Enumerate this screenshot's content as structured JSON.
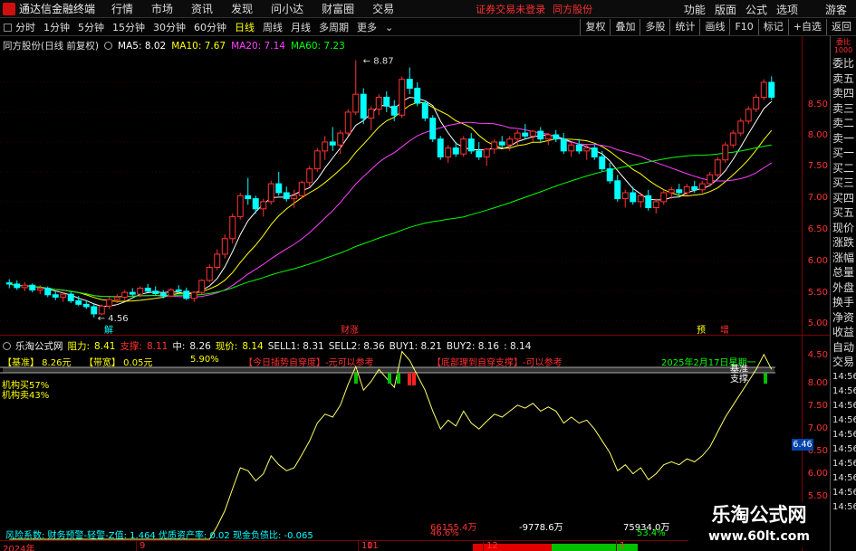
{
  "menubar": {
    "app_title": "通达信金融终端",
    "items": [
      "行情",
      "市场",
      "资讯",
      "发现",
      "问小达",
      "财富圈",
      "交易"
    ],
    "notice": "证券交易未登录",
    "broker": "同方股份",
    "right_items": [
      "功能",
      "版面",
      "公式",
      "选项"
    ],
    "guest": "游客"
  },
  "toolbar": {
    "periods": [
      "分时",
      "1分钟",
      "5分钟",
      "15分钟",
      "30分钟",
      "60分钟",
      "日线",
      "周线",
      "月线",
      "多周期",
      "更多"
    ],
    "active_period": "日线",
    "right_buttons": [
      "复权",
      "叠加",
      "多股",
      "统计",
      "画线",
      "F10",
      "标记",
      "+自选",
      "返回"
    ]
  },
  "stock_header": {
    "name": "同方股份(日线 前复权)",
    "ma5": "MA5: 8.02",
    "ma10": "MA10: 7.67",
    "ma20": "MA20: 7.14",
    "ma60": "MA60: 7.23"
  },
  "chart_markers": {
    "high": "8.87",
    "low": "4.56",
    "caizhang": "财涨",
    "jie": "解",
    "yu": "预",
    "zeng": "增"
  },
  "price_axis": [
    "8.50",
    "8.00",
    "7.50",
    "7.00",
    "6.50",
    "6.00",
    "5.50",
    "5.00",
    "4.50"
  ],
  "indicator_axis": [
    "8.00",
    "7.50",
    "7.00",
    "6.50",
    "6.00",
    "5.50"
  ],
  "indicator_tag": "6.46",
  "indicator_header": {
    "name": "乐淘公式网",
    "resistance_label": "阻力:",
    "resistance": "8.41",
    "support_label": "支撑:",
    "support": "8.11",
    "mid_label": "中:",
    "mid": "8.26",
    "current_label": "现价:",
    "current": "8.14",
    "sell1": "SELL1: 8.31",
    "sell2": "SELL2: 8.36",
    "buy1": "BUY1: 8.21",
    "buy2": "BUY2: 8.16",
    "extra": ": 8.14"
  },
  "indicator_row2": {
    "base": "【基准】 8.26元",
    "width": "【带宽】 0.05元",
    "pct": "5.90%",
    "hint1": "【今日插势自穿度】-元可以参考",
    "hint2": "【底部理到自穿支撑】-可以参考",
    "date": "2025年2月17日星期一"
  },
  "indicator_left": {
    "inst_buy": "机构买57%",
    "inst_sell": "机构卖43%"
  },
  "indicator_annotations": {
    "base": "基准",
    "support": "支撑"
  },
  "bottom_info": "风险系数: 财务预警-轻警-Z值: 1.464  优质资产率: 0.02  现金负债比: -0.065",
  "flow": {
    "left_value": "66155.4万",
    "left_pct": "46.6%",
    "mid_value": "-9778.6万",
    "right_value": "75934.0万",
    "right_pct": "53.4%"
  },
  "date_axis": [
    "2024年",
    "9",
    "10",
    "11",
    "12",
    "1"
  ],
  "side_panel": {
    "header": "委比 1000",
    "items": [
      "委比",
      "卖五",
      "卖四",
      "卖三",
      "卖二",
      "卖一",
      "买一",
      "买二",
      "买三",
      "买四",
      "买五",
      "现价",
      "涨跌",
      "涨幅",
      "总量",
      "外盘",
      "换手",
      "净资",
      "收益",
      "自动",
      "交易"
    ],
    "times": [
      "14:56",
      "14:56",
      "14:56",
      "14:56",
      "14:56",
      "14:56",
      "14:56",
      "14:56",
      "14:56",
      "14:56"
    ]
  },
  "watermark": {
    "title": "乐淘公式网",
    "url": "www.60lt.com"
  },
  "colors": {
    "up": "#ff3333",
    "down": "#00ffff",
    "ma5": "#ffffff",
    "ma10": "#ffff00",
    "ma20": "#ff40ff",
    "ma60": "#00ff00",
    "indicator_line": "#ffff66"
  },
  "chart_data": {
    "type": "candlestick",
    "title": "同方股份(日线 前复权)",
    "candles": [
      [
        5.14,
        5.2,
        5.05,
        5.12
      ],
      [
        5.12,
        5.18,
        5.02,
        5.06
      ],
      [
        5.06,
        5.15,
        5.0,
        5.1
      ],
      [
        5.1,
        5.13,
        4.98,
        5.02
      ],
      [
        5.02,
        5.1,
        4.95,
        5.05
      ],
      [
        5.05,
        5.08,
        4.9,
        4.94
      ],
      [
        4.94,
        5.0,
        4.85,
        4.9
      ],
      [
        4.9,
        4.98,
        4.82,
        4.95
      ],
      [
        4.95,
        5.0,
        4.8,
        4.84
      ],
      [
        4.84,
        4.92,
        4.75,
        4.78
      ],
      [
        4.78,
        4.85,
        4.7,
        4.74
      ],
      [
        4.74,
        4.8,
        4.56,
        4.62
      ],
      [
        4.62,
        4.78,
        4.6,
        4.75
      ],
      [
        4.75,
        4.9,
        4.7,
        4.86
      ],
      [
        4.86,
        4.95,
        4.8,
        4.9
      ],
      [
        4.9,
        5.02,
        4.85,
        4.98
      ],
      [
        4.98,
        5.05,
        4.92,
        4.95
      ],
      [
        4.95,
        5.08,
        4.9,
        5.05
      ],
      [
        5.05,
        5.12,
        4.98,
        5.0
      ],
      [
        5.0,
        5.08,
        4.92,
        4.96
      ],
      [
        4.96,
        5.02,
        4.88,
        4.92
      ],
      [
        4.92,
        5.05,
        4.9,
        5.02
      ],
      [
        5.02,
        5.1,
        4.96,
        5.0
      ],
      [
        5.0,
        5.06,
        4.85,
        4.88
      ],
      [
        4.88,
        5.0,
        4.82,
        4.98
      ],
      [
        4.98,
        5.2,
        4.95,
        5.18
      ],
      [
        5.18,
        5.45,
        5.15,
        5.4
      ],
      [
        5.4,
        5.7,
        5.35,
        5.62
      ],
      [
        5.62,
        5.95,
        5.55,
        5.88
      ],
      [
        5.88,
        6.3,
        5.8,
        6.25
      ],
      [
        6.25,
        6.65,
        6.2,
        6.6
      ],
      [
        6.6,
        6.9,
        6.45,
        6.55
      ],
      [
        6.55,
        6.6,
        6.3,
        6.38
      ],
      [
        6.38,
        6.55,
        6.25,
        6.5
      ],
      [
        6.5,
        6.85,
        6.45,
        6.8
      ],
      [
        6.8,
        7.0,
        6.6,
        6.65
      ],
      [
        6.65,
        6.75,
        6.5,
        6.55
      ],
      [
        6.55,
        6.7,
        6.4,
        6.6
      ],
      [
        6.6,
        6.85,
        6.55,
        6.82
      ],
      [
        6.82,
        7.1,
        6.75,
        7.05
      ],
      [
        7.05,
        7.4,
        7.0,
        7.35
      ],
      [
        7.35,
        7.6,
        7.2,
        7.5
      ],
      [
        7.5,
        7.75,
        7.35,
        7.45
      ],
      [
        7.45,
        7.7,
        7.3,
        7.65
      ],
      [
        7.65,
        8.05,
        7.6,
        8.0
      ],
      [
        8.0,
        8.87,
        7.95,
        8.3
      ],
      [
        8.3,
        8.4,
        7.8,
        7.9
      ],
      [
        7.9,
        8.1,
        7.7,
        8.05
      ],
      [
        8.05,
        8.3,
        7.95,
        8.25
      ],
      [
        8.25,
        8.35,
        8.0,
        8.1
      ],
      [
        8.1,
        8.2,
        7.85,
        7.95
      ],
      [
        7.95,
        8.6,
        7.9,
        8.55
      ],
      [
        8.55,
        8.75,
        8.3,
        8.4
      ],
      [
        8.4,
        8.5,
        8.1,
        8.15
      ],
      [
        8.15,
        8.2,
        7.85,
        7.9
      ],
      [
        7.9,
        7.95,
        7.5,
        7.55
      ],
      [
        7.55,
        7.6,
        7.2,
        7.25
      ],
      [
        7.25,
        7.45,
        7.15,
        7.4
      ],
      [
        7.4,
        7.5,
        7.25,
        7.3
      ],
      [
        7.3,
        7.6,
        7.25,
        7.55
      ],
      [
        7.55,
        7.65,
        7.3,
        7.35
      ],
      [
        7.35,
        7.5,
        7.2,
        7.25
      ],
      [
        7.25,
        7.4,
        7.1,
        7.38
      ],
      [
        7.38,
        7.55,
        7.3,
        7.5
      ],
      [
        7.5,
        7.6,
        7.4,
        7.45
      ],
      [
        7.45,
        7.6,
        7.35,
        7.55
      ],
      [
        7.55,
        7.7,
        7.45,
        7.65
      ],
      [
        7.65,
        7.8,
        7.55,
        7.6
      ],
      [
        7.6,
        7.7,
        7.5,
        7.68
      ],
      [
        7.68,
        7.75,
        7.5,
        7.55
      ],
      [
        7.55,
        7.65,
        7.45,
        7.62
      ],
      [
        7.62,
        7.7,
        7.5,
        7.55
      ],
      [
        7.55,
        7.65,
        7.3,
        7.35
      ],
      [
        7.35,
        7.5,
        7.25,
        7.45
      ],
      [
        7.45,
        7.55,
        7.3,
        7.35
      ],
      [
        7.35,
        7.45,
        7.2,
        7.4
      ],
      [
        7.4,
        7.45,
        7.2,
        7.25
      ],
      [
        7.25,
        7.35,
        7.0,
        7.05
      ],
      [
        7.05,
        7.15,
        6.8,
        6.85
      ],
      [
        6.85,
        6.95,
        6.5,
        6.55
      ],
      [
        6.55,
        6.7,
        6.4,
        6.65
      ],
      [
        6.65,
        6.75,
        6.45,
        6.5
      ],
      [
        6.5,
        6.65,
        6.4,
        6.6
      ],
      [
        6.6,
        6.7,
        6.35,
        6.4
      ],
      [
        6.4,
        6.55,
        6.3,
        6.5
      ],
      [
        6.5,
        6.7,
        6.45,
        6.65
      ],
      [
        6.65,
        6.75,
        6.55,
        6.7
      ],
      [
        6.7,
        6.8,
        6.6,
        6.65
      ],
      [
        6.65,
        6.8,
        6.6,
        6.75
      ],
      [
        6.75,
        6.85,
        6.65,
        6.7
      ],
      [
        6.7,
        6.85,
        6.65,
        6.8
      ],
      [
        6.8,
        7.0,
        6.75,
        6.95
      ],
      [
        6.95,
        7.25,
        6.9,
        7.2
      ],
      [
        7.2,
        7.5,
        7.15,
        7.45
      ],
      [
        7.45,
        7.7,
        7.4,
        7.65
      ],
      [
        7.65,
        7.9,
        7.6,
        7.85
      ],
      [
        7.85,
        8.1,
        7.8,
        8.05
      ],
      [
        8.05,
        8.3,
        8.0,
        8.25
      ],
      [
        8.25,
        8.55,
        8.2,
        8.5
      ],
      [
        8.5,
        8.6,
        8.2,
        8.25
      ]
    ],
    "price_range": [
      4.3,
      9.0
    ],
    "ind_range": [
      5.4,
      8.3
    ]
  }
}
